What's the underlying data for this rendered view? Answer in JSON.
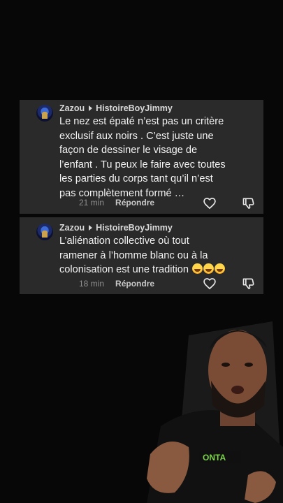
{
  "comments": [
    {
      "author": "Zazou",
      "reply_to": "HistoireBoyJimmy",
      "lines": [
        "Le nez est épaté n’est pas un critère",
        "exclusif aux noirs . C’est juste une",
        "façon de dessiner le visage de",
        "l’enfant . Tu peux le faire avec toutes",
        "les parties du corps tant qu’il n’est",
        "pas complètement formé …"
      ],
      "time": "21 min",
      "reply_label": "Répondre"
    },
    {
      "author": "Zazou",
      "reply_to": "HistoireBoyJimmy",
      "lines": [
        "L’aliénation collective où tout",
        "ramener à l’homme blanc ou à la",
        "colonisation est une tradition"
      ],
      "time": "18 min",
      "reply_label": "Répondre"
    }
  ],
  "shirt_text": "ONTA",
  "icons": [
    "heart-icon",
    "dislike-icon",
    "laughing-emoji"
  ]
}
